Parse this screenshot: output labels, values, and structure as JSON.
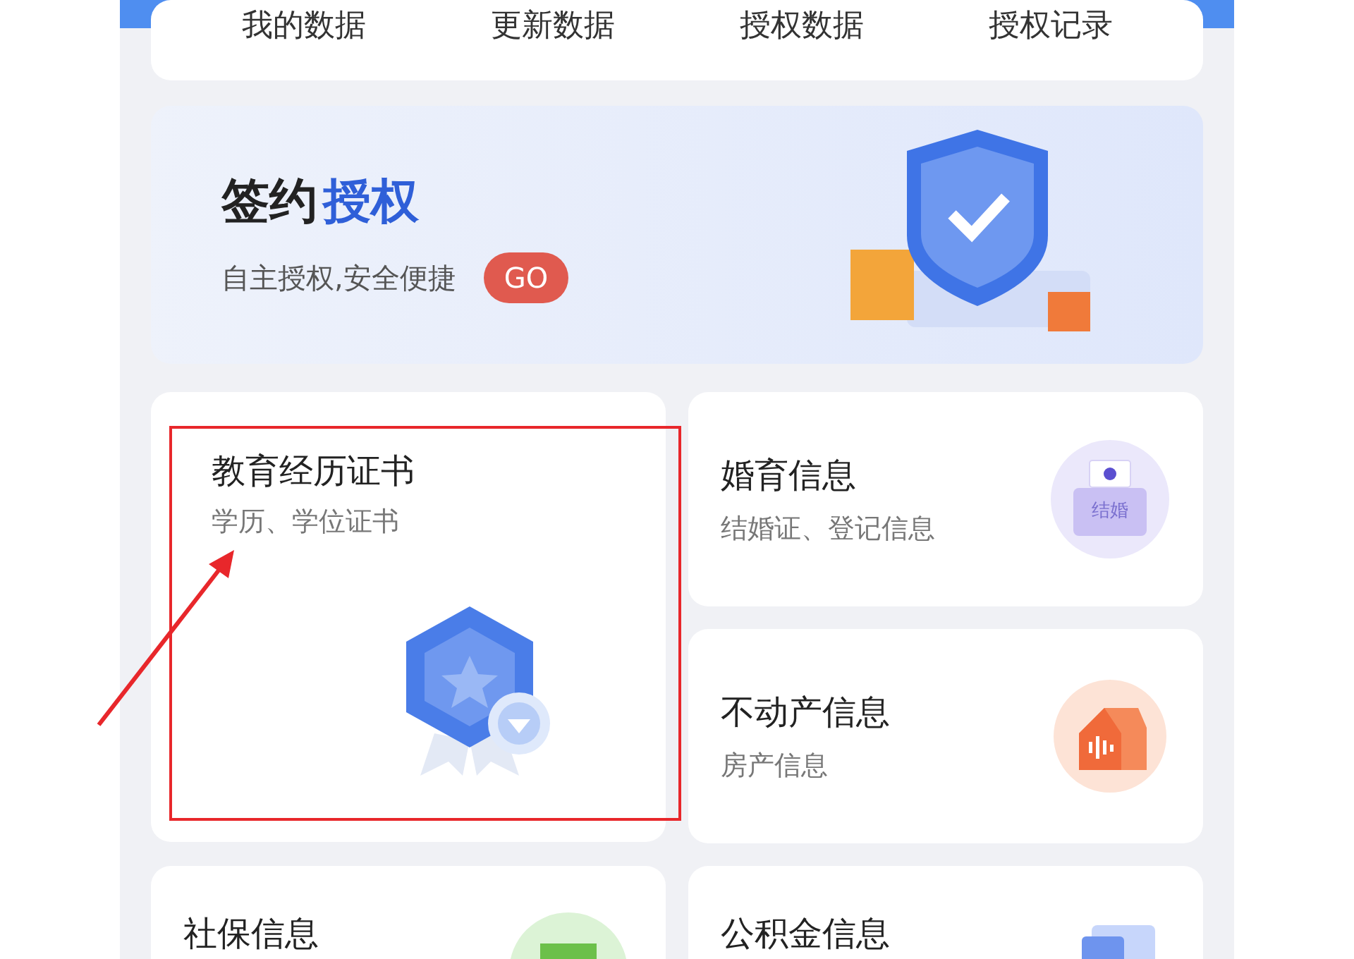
{
  "top_tabs": [
    "我的数据",
    "更新数据",
    "授权数据",
    "授权记录"
  ],
  "banner": {
    "title_plain": "签约",
    "title_accent": "授权",
    "subtitle": "自主授权,安全便捷",
    "go": "GO"
  },
  "cards": [
    {
      "kind": "education",
      "title": "教育经历证书",
      "subtitle": "学历、学位证书",
      "highlighted": true
    },
    {
      "kind": "marriage",
      "title": "婚育信息",
      "subtitle": "结婚证、登记信息",
      "badge_text": "结婚",
      "highlighted": false
    },
    {
      "kind": "property",
      "title": "不动产信息",
      "subtitle": "房产信息",
      "highlighted": false
    },
    {
      "kind": "social",
      "title": "社保信息"
    },
    {
      "kind": "fund",
      "title": "公积金信息"
    }
  ]
}
